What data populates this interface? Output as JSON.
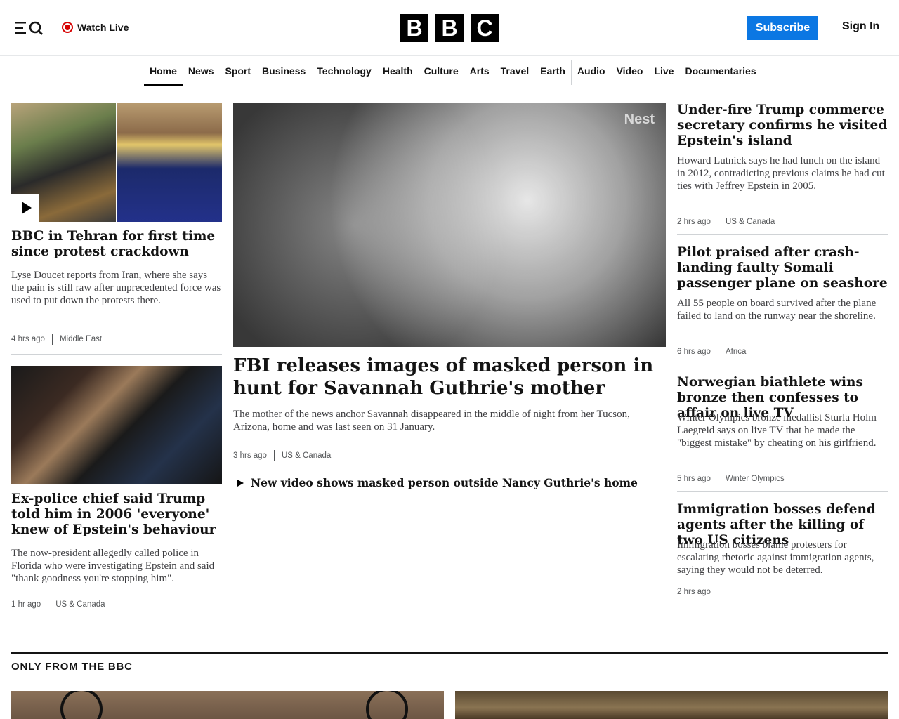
{
  "header": {
    "watch_live": "Watch Live",
    "logo_letters": [
      "B",
      "B",
      "C"
    ],
    "subscribe": "Subscribe",
    "sign_in": "Sign In"
  },
  "nav": {
    "items": [
      "Home",
      "News",
      "Sport",
      "Business",
      "Technology",
      "Health",
      "Culture",
      "Arts",
      "Travel",
      "Earth",
      "Audio",
      "Video",
      "Live",
      "Documentaries"
    ],
    "active": "Home"
  },
  "left_col": {
    "story1": {
      "headline": "BBC in Tehran for first time since protest crackdown",
      "summary": "Lyse Doucet reports from Iran, where she says the pain is still raw after unprecedented force was used to put down the protests there.",
      "time": "4 hrs ago",
      "category": "Middle East"
    },
    "story2": {
      "headline": "Ex-police chief said Trump told him in 2006 'everyone' knew of Epstein's behaviour",
      "summary": "The now-president allegedly called police in Florida who were investigating Epstein and said \"thank goodness you're stopping him\".",
      "time": "1 hr ago",
      "category": "US & Canada"
    }
  },
  "lead": {
    "image_watermark": "Nest",
    "headline": "FBI releases images of masked person in hunt for Savannah Guthrie's mother",
    "summary": "The mother of the news anchor Savannah disappeared in the middle of night from her Tucson, Arizona, home and was last seen on 31 January.",
    "time": "3 hrs ago",
    "category": "US & Canada",
    "related": "New video shows masked person outside Nancy Guthrie's home"
  },
  "right_col": [
    {
      "headline": "Under-fire Trump commerce secretary confirms he visited Epstein's island",
      "summary": "Howard Lutnick says he had lunch on the island in 2012, contradicting previous claims he had cut ties with Jeffrey Epstein in 2005.",
      "time": "2 hrs ago",
      "category": "US & Canada"
    },
    {
      "headline": "Pilot praised after crash-landing faulty Somali passenger plane on seashore",
      "summary": "All 55 people on board survived after the plane failed to land on the runway near the shoreline.",
      "time": "6 hrs ago",
      "category": "Africa"
    },
    {
      "headline": "Norwegian biathlete wins bronze then confesses to affair on live TV",
      "summary": "Winter Olympics bronze medallist Sturla Holm Laegreid says on live TV that he made the \"biggest mistake\" by cheating on his girlfriend.",
      "time": "5 hrs ago",
      "category": "Winter Olympics"
    },
    {
      "headline": "Immigration bosses defend agents after the killing of two US citizens",
      "summary": "Immigration bosses blame protesters for escalating rhetoric against immigration agents, saying they would not be deterred.",
      "time": "2 hrs ago",
      "category": ""
    }
  ],
  "section": {
    "title": "ONLY FROM THE BBC"
  }
}
